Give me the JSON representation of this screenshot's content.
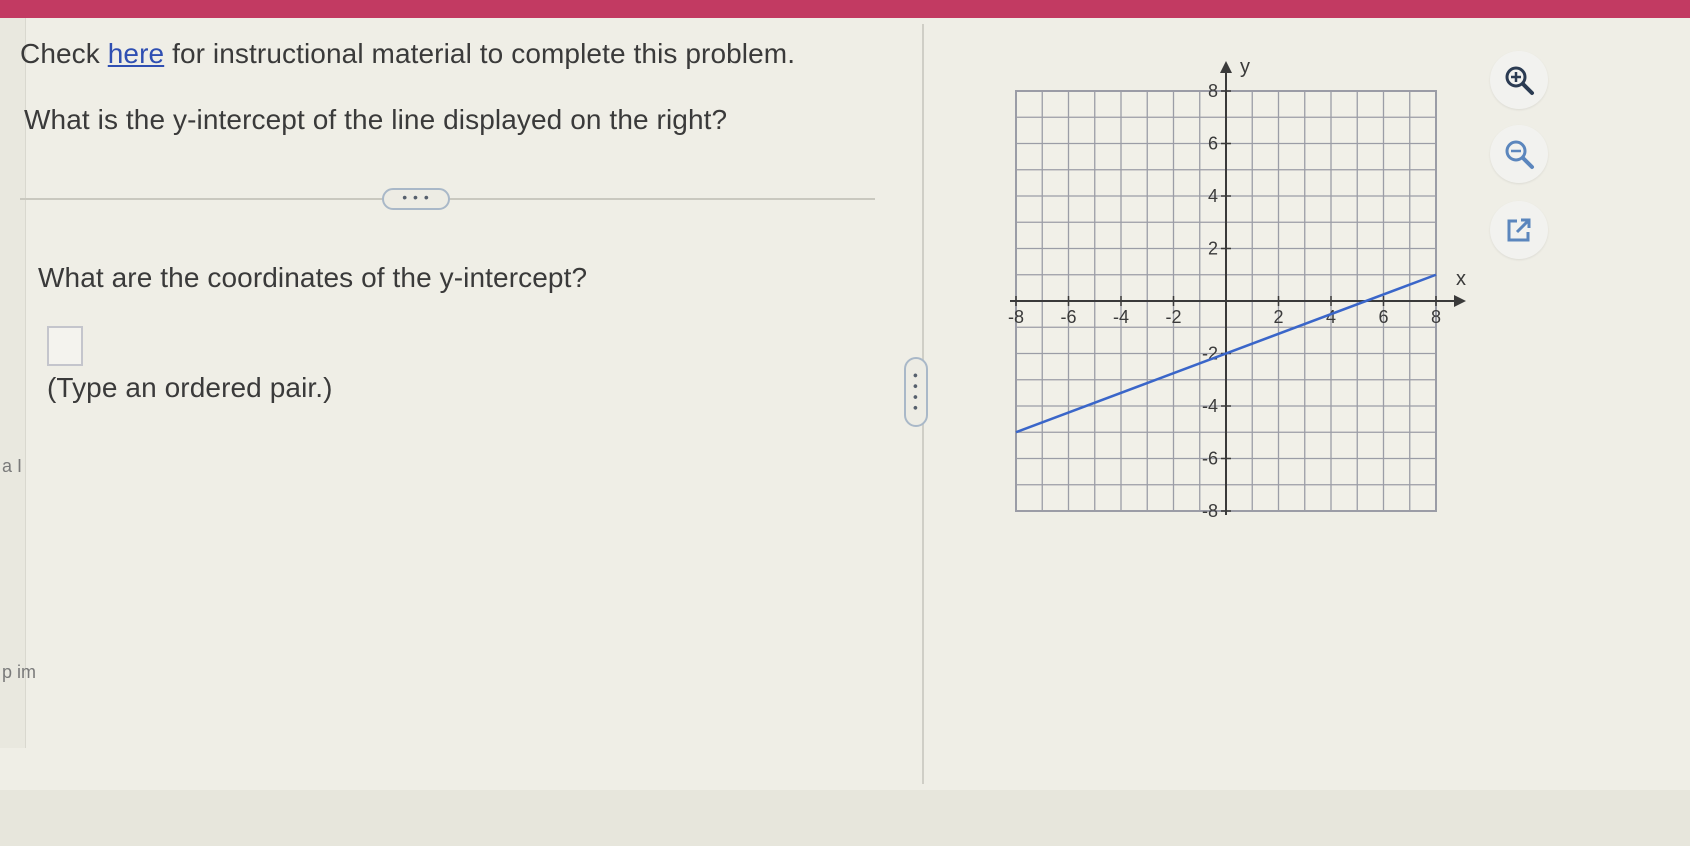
{
  "prompt": {
    "check_prefix": "Check ",
    "here_link": "here",
    "check_suffix": " for instructional material to complete this problem.",
    "question": "What is the y-intercept of the line displayed on the right?"
  },
  "divider": {
    "label": "• • •"
  },
  "subquestion": {
    "text": "What are the coordinates of the y-intercept?",
    "answer_value": "",
    "hint": "(Type an ordered pair.)"
  },
  "splitter": {
    "label": "• • • •"
  },
  "edge_text": {
    "top": "a I",
    "bottom": "p im"
  },
  "toolbar": {
    "zoom_in": "zoom-in-icon",
    "zoom_out": "zoom-out-icon",
    "open_external": "external-link-icon"
  },
  "colors": {
    "accent_bar": "#c23a62",
    "link": "#2f4fb2",
    "line": "#3a66c9",
    "grid": "#9b9da6"
  },
  "chart_data": {
    "type": "line",
    "xlabel": "x",
    "ylabel": "y",
    "xlim": [
      -8,
      8
    ],
    "ylim": [
      -8,
      8
    ],
    "grid": true,
    "x_ticks": [
      -8,
      -6,
      -4,
      -2,
      2,
      4,
      6,
      8
    ],
    "y_ticks": [
      -8,
      -6,
      -4,
      -2,
      2,
      4,
      6,
      8
    ],
    "x_tick_labels": [
      "-8",
      "-6",
      "-4",
      "-2",
      "2",
      "4",
      "6",
      "8"
    ],
    "y_tick_labels": [
      "-8",
      "-6",
      "-4",
      "-2",
      "2",
      "4",
      "6",
      "8"
    ],
    "series": [
      {
        "x": [
          -8,
          8
        ],
        "y": [
          -5,
          1
        ]
      }
    ]
  }
}
